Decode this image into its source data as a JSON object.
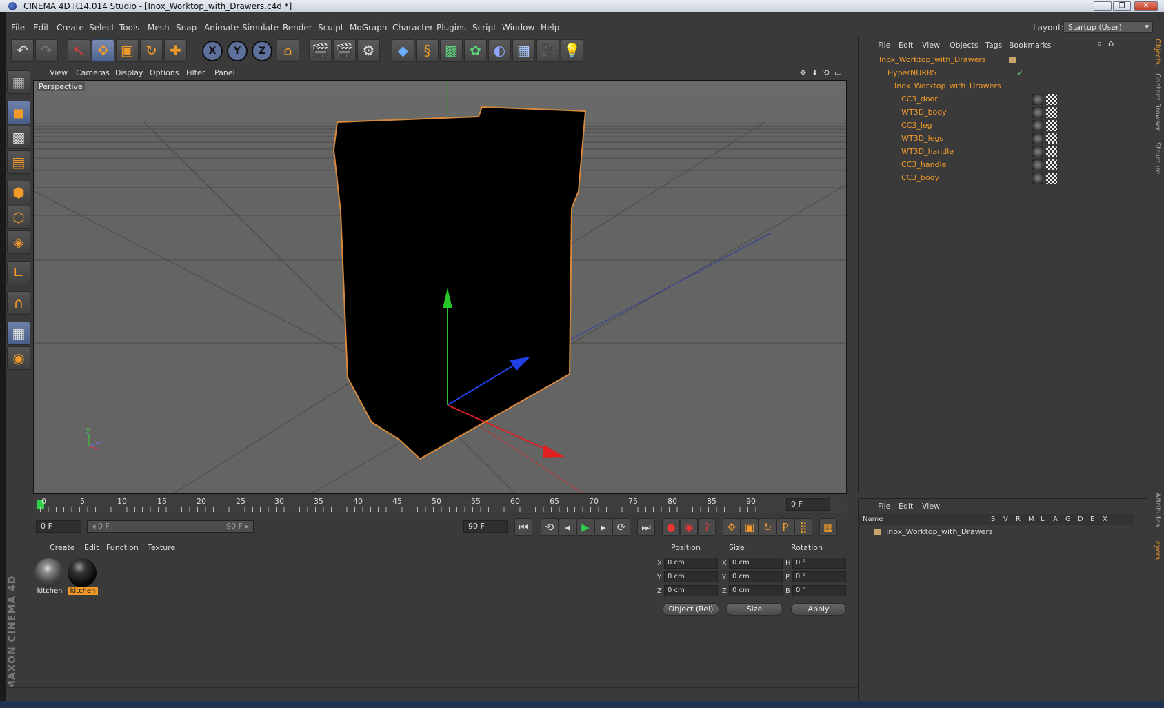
{
  "window": {
    "title": "CINEMA 4D R14.014 Studio - [Inox_Worktop_with_Drawers.c4d *]",
    "minimize": "–",
    "restore": "❐",
    "close": "✕"
  },
  "menus": [
    "File",
    "Edit",
    "Create",
    "Select",
    "Tools",
    "Mesh",
    "Snap",
    "Animate",
    "Simulate",
    "Render",
    "Sculpt",
    "MoGraph",
    "Character",
    "Plugins",
    "Script",
    "Window",
    "Help"
  ],
  "layout": {
    "label": "Layout:",
    "value": "Startup (User)"
  },
  "toolbar": {
    "undo": "↶",
    "redo": "↷",
    "live_select": "↖",
    "move": "✥",
    "scale": "▣",
    "rotate": "↻",
    "last_tool": "✚",
    "x_axis": "X",
    "y_axis": "Y",
    "z_axis": "Z",
    "world": "⌂",
    "render_view": "🎬",
    "render_picture": "🎬",
    "render_settings": "⚙",
    "cube": "◆",
    "spline": "§",
    "nurbs": "▩",
    "array": "✿",
    "deformer": "◐",
    "floor": "▦",
    "camera": "🎥",
    "light": "💡"
  },
  "left_tools": [
    "▦",
    "◼",
    "▩",
    "▤",
    "⬢",
    "⬡",
    "◈",
    "∟",
    "∩",
    "▦",
    "◉"
  ],
  "maxon": "MAXON CINEMA 4D",
  "viewport": {
    "menus": [
      "View",
      "Cameras",
      "Display",
      "Options",
      "Filter",
      "Panel"
    ],
    "label": "Perspective",
    "nav_icons": "✥ ⬇ ⟲ ▭"
  },
  "timeline": {
    "ticks": [
      "0",
      "5",
      "10",
      "15",
      "20",
      "25",
      "30",
      "35",
      "40",
      "45",
      "50",
      "55",
      "60",
      "65",
      "70",
      "75",
      "80",
      "85",
      "90"
    ],
    "current_frame": "0 F"
  },
  "transport": {
    "start": "0 F",
    "range_start": "◂ 0 F",
    "range_end": "90 F ▸",
    "end": "90 F",
    "buttons": [
      "⏮",
      "⟲",
      "◂",
      "▶",
      "▸",
      "⟳",
      "⏭"
    ],
    "record_buttons": [
      "●",
      "◉",
      "?"
    ],
    "key_buttons": [
      "✥",
      "▣",
      "↻",
      "P",
      "⣿",
      "▦"
    ]
  },
  "material_manager": {
    "menus": [
      "Create",
      "Edit",
      "Function",
      "Texture"
    ],
    "materials": [
      {
        "label": "kitchen",
        "selected": false
      },
      {
        "label": "kitchen",
        "selected": true
      }
    ]
  },
  "attributes": {
    "headers": [
      "Position",
      "Size",
      "Rotation"
    ],
    "rows": [
      {
        "l1": "X",
        "v1": "0 cm",
        "l2": "X",
        "v2": "0 cm",
        "l3": "H",
        "v3": "0 °"
      },
      {
        "l1": "Y",
        "v1": "0 cm",
        "l2": "Y",
        "v2": "0 cm",
        "l3": "P",
        "v3": "0 °"
      },
      {
        "l1": "Z",
        "v1": "0 cm",
        "l2": "Z",
        "v2": "0 cm",
        "l3": "B",
        "v3": "0 °"
      }
    ],
    "mode": "Object (Rel)",
    "size_mode": "Size",
    "apply": "Apply"
  },
  "object_manager": {
    "menus": [
      "File",
      "Edit",
      "View",
      "Objects",
      "Tags",
      "Bookmarks"
    ],
    "tree": [
      {
        "name": "Inox_Worktop_with_Drawers",
        "indent": 0
      },
      {
        "name": "HyperNURBS",
        "indent": 1
      },
      {
        "name": "Inox_Worktop_with_Drawers",
        "indent": 2
      },
      {
        "name": "CC3_door",
        "indent": 3
      },
      {
        "name": "WT3D_body",
        "indent": 3
      },
      {
        "name": "CC3_leg",
        "indent": 3
      },
      {
        "name": "WT3D_legs",
        "indent": 3
      },
      {
        "name": "WT3D_handle",
        "indent": 3
      },
      {
        "name": "CC3_handle",
        "indent": 3
      },
      {
        "name": "CC3_body",
        "indent": 3
      }
    ],
    "check_mark": "✓"
  },
  "side_tabs": [
    "Objects",
    "Content Browser",
    "Structure",
    "Attributes",
    "Layers"
  ],
  "layer_manager": {
    "menus": [
      "File",
      "Edit",
      "View"
    ],
    "columns": [
      "Name",
      "S",
      "V",
      "R",
      "M",
      "L",
      "A",
      "G",
      "D",
      "E",
      "X"
    ],
    "rows": [
      {
        "name": "Inox_Worktop_with_Drawers"
      }
    ]
  },
  "colors": {
    "accent": "#f19a2a",
    "selected": "#5d6f9b"
  }
}
